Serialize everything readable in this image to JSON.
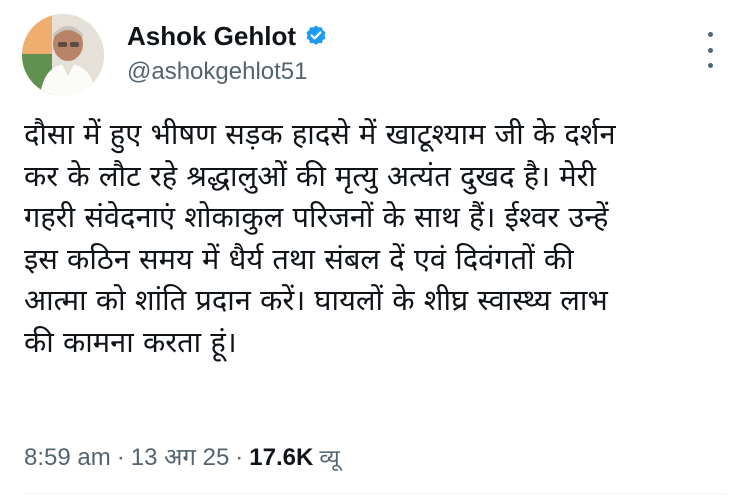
{
  "author": {
    "display_name": "Ashok Gehlot",
    "handle": "@ashokgehlot51",
    "verified_icon": "verified-badge-icon",
    "avatar_icon": "avatar-photo"
  },
  "more_menu_icon": "more-options-icon",
  "tweet": {
    "lines": [
      "दौसा में हुए भीषण सड़क हादसे में खाटूश्याम जी के दर्शन",
      "कर के लौट रहे श्रद्धालुओं की मृत्यु अत्यंत दुखद है। मेरी",
      "गहरी संवेदनाएं शोकाकुल परिजनों के साथ हैं। ईश्वर उन्हें",
      "इस कठिन समय में धैर्य तथा संबल दें एवं दिवंगतों की",
      "आत्मा को शांति प्रदान करें। घायलों के शीघ्र स्वास्थ्य लाभ",
      "की कामना करता हूं।"
    ]
  },
  "meta": {
    "time": "8:59 am",
    "separator": "·",
    "date": "13 अग 25",
    "views_count": "17.6K",
    "views_label": "व्यू"
  },
  "colors": {
    "text": "#0f1419",
    "secondary": "#536471",
    "verified": "#1d9bf0",
    "divider": "#eff3f4"
  }
}
